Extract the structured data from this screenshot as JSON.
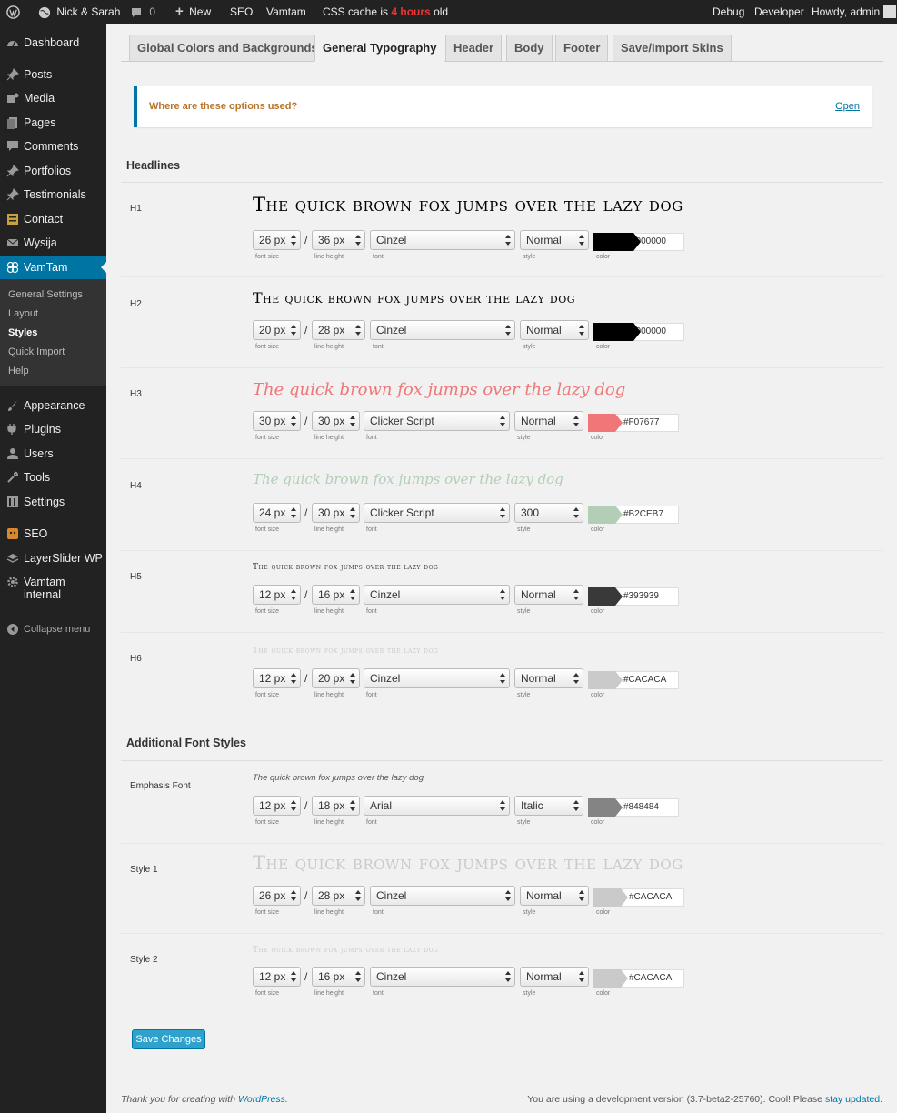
{
  "adminbar": {
    "site_name": "Nick & Sarah",
    "comments_count": "0",
    "new_label": "New",
    "seo_label": "SEO",
    "vamtam_label": "Vamtam",
    "css_cache_prefix": "CSS cache is",
    "css_cache_age": "4 hours",
    "css_cache_suffix": "old",
    "debug_label": "Debug",
    "developer_label": "Developer",
    "howdy_label": "Howdy, admin"
  },
  "sidebar": {
    "dashboard": "Dashboard",
    "posts": "Posts",
    "media": "Media",
    "pages": "Pages",
    "comments": "Comments",
    "portfolios": "Portfolios",
    "testimonials": "Testimonials",
    "contact": "Contact",
    "wysija": "Wysija",
    "vamtam": "VamTam",
    "sub_general": "General Settings",
    "sub_layout": "Layout",
    "sub_styles": "Styles",
    "sub_quick_import": "Quick Import",
    "sub_help": "Help",
    "appearance": "Appearance",
    "plugins": "Plugins",
    "users": "Users",
    "tools": "Tools",
    "settings": "Settings",
    "seo": "SEO",
    "layerslider": "LayerSlider WP",
    "vamtam_internal_1": "Vamtam",
    "vamtam_internal_2": "internal",
    "collapse": "Collapse menu"
  },
  "tabs": {
    "global": "Global Colors and Backgrounds",
    "typography": "General Typography",
    "header": "Header",
    "body": "Body",
    "footer": "Footer",
    "skins": "Save/Import Skins"
  },
  "notice": {
    "text": "Where are these options used?",
    "open": "Open"
  },
  "sections": {
    "headlines": "Headlines",
    "additional": "Additional Font Styles"
  },
  "captions": {
    "font_size": "font size",
    "line_height": "line height",
    "font": "font",
    "style": "style",
    "color": "color"
  },
  "rows": {
    "h1": {
      "label": "H1",
      "preview": "The quick brown fox jumps over the lazy dog",
      "size": "26 px",
      "line": "36 px",
      "font": "Cinzel",
      "style": "Normal",
      "color": "#000000"
    },
    "h2": {
      "label": "H2",
      "preview": "The quick brown fox jumps over the lazy dog",
      "size": "20 px",
      "line": "28 px",
      "font": "Cinzel",
      "style": "Normal",
      "color": "#000000"
    },
    "h3": {
      "label": "H3",
      "preview": "The quick brown fox jumps over the lazy dog",
      "size": "30 px",
      "line": "30 px",
      "font": "Clicker Script",
      "style": "Normal",
      "color": "#F07677"
    },
    "h4": {
      "label": "H4",
      "preview": "The quick brown fox jumps over the lazy dog",
      "size": "24 px",
      "line": "30 px",
      "font": "Clicker Script",
      "style": "300",
      "color": "#B2CEB7"
    },
    "h5": {
      "label": "H5",
      "preview": "The quick brown fox jumps over the lazy dog",
      "size": "12 px",
      "line": "16 px",
      "font": "Cinzel",
      "style": "Normal",
      "color": "#393939"
    },
    "h6": {
      "label": "H6",
      "preview": "The quick brown fox jumps over the lazy dog",
      "size": "12 px",
      "line": "20 px",
      "font": "Cinzel",
      "style": "Normal",
      "color": "#CACACA"
    },
    "em": {
      "label": "Emphasis Font",
      "preview": "The quick brown fox jumps over the lazy dog",
      "size": "12 px",
      "line": "18 px",
      "font": "Arial",
      "style": "Italic",
      "color": "#848484"
    },
    "s1": {
      "label": "Style 1",
      "preview": "The quick brown fox jumps over the lazy dog",
      "size": "26 px",
      "line": "28 px",
      "font": "Cinzel",
      "style": "Normal",
      "color": "#CACACA"
    },
    "s2": {
      "label": "Style 2",
      "preview": "The quick brown fox jumps over the lazy dog",
      "size": "12 px",
      "line": "16 px",
      "font": "Cinzel",
      "style": "Normal",
      "color": "#CACACA"
    }
  },
  "save_label": "Save Changes",
  "footer": {
    "thanks_prefix": "Thank you for creating with",
    "thanks_link": "WordPress",
    "thanks_suffix": ".",
    "version_text": "You are using a development version (3.7-beta2-25760). Cool! Please",
    "version_link": "stay updated",
    "version_suffix": "."
  }
}
